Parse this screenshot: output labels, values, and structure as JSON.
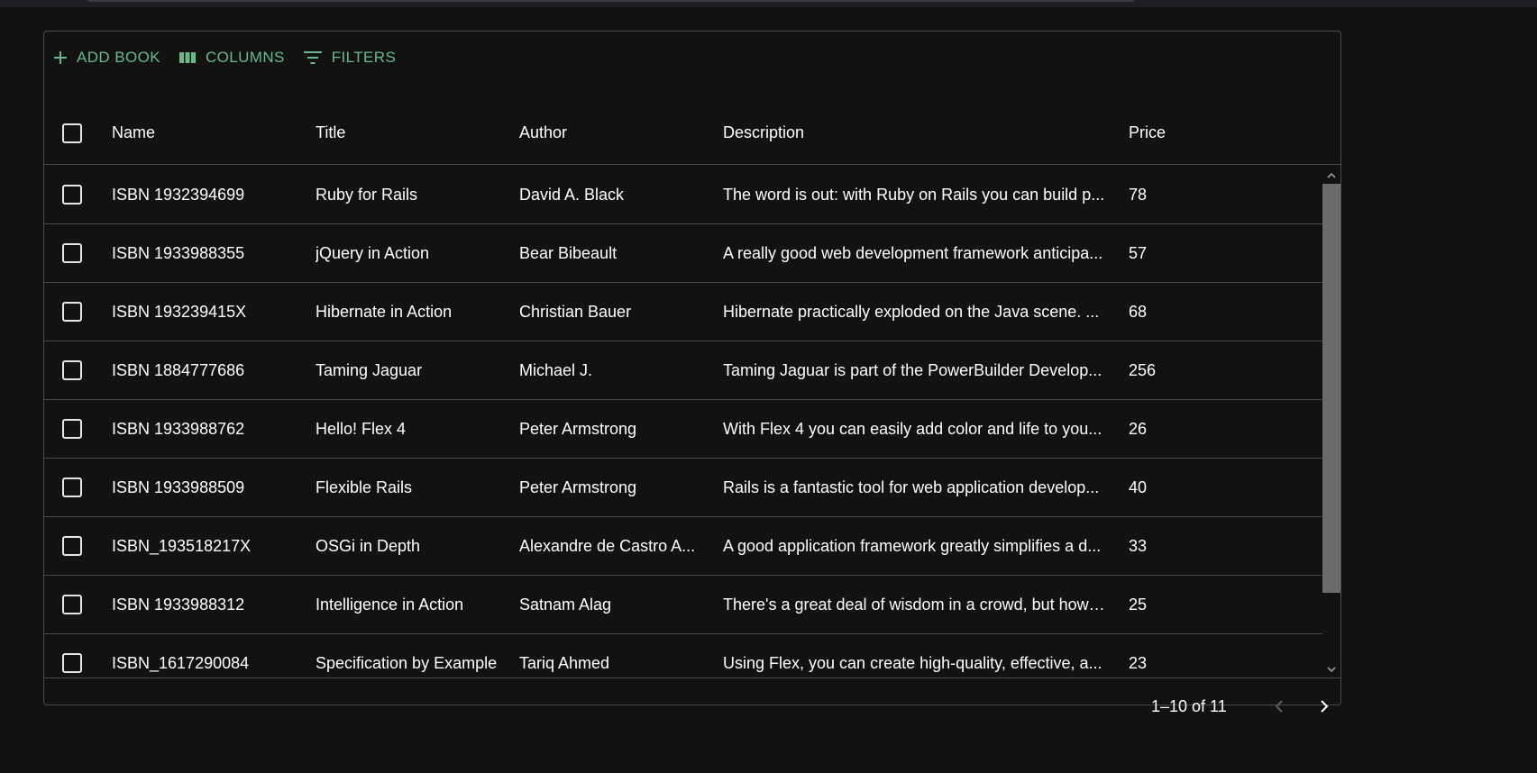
{
  "toolbar": {
    "add_label": "Add Book",
    "columns_label": "Columns",
    "filters_label": "Filters"
  },
  "columns": [
    "Name",
    "Title",
    "Author",
    "Description",
    "Price"
  ],
  "rows": [
    {
      "name": "ISBN 1932394699",
      "title": "Ruby for Rails",
      "author": "David A. Black",
      "description": "The word is out: with Ruby on Rails you can build p...",
      "price": "78"
    },
    {
      "name": "ISBN 1933988355",
      "title": "jQuery in Action",
      "author": "Bear Bibeault",
      "description": "A really good web development framework anticipa...",
      "price": "57"
    },
    {
      "name": "ISBN 193239415X",
      "title": "Hibernate in Action",
      "author": "Christian Bauer",
      "description": "Hibernate practically exploded on the Java scene. ...",
      "price": "68"
    },
    {
      "name": "ISBN 1884777686",
      "title": "Taming Jaguar",
      "author": "Michael J.",
      "description": "Taming Jaguar is part of the PowerBuilder Develop...",
      "price": "256"
    },
    {
      "name": "ISBN 1933988762",
      "title": "Hello! Flex 4",
      "author": "Peter Armstrong",
      "description": "With Flex 4 you can easily add color and life to you...",
      "price": "26"
    },
    {
      "name": "ISBN 1933988509",
      "title": "Flexible Rails",
      "author": "Peter Armstrong",
      "description": "Rails is a fantastic tool for web application develop...",
      "price": "40"
    },
    {
      "name": "ISBN_193518217X",
      "title": "OSGi in Depth",
      "author": "Alexandre de Castro A...",
      "description": "A good application framework greatly simplifies a d...",
      "price": "33"
    },
    {
      "name": "ISBN 1933988312",
      "title": "Intelligence in Action",
      "author": "Satnam Alag",
      "description": "There's a great deal of wisdom in a crowd, but how ...",
      "price": "25"
    },
    {
      "name": "ISBN_1617290084",
      "title": "Specification by Example",
      "author": "Tariq Ahmed",
      "description": "Using Flex, you can create high-quality, effective, a...",
      "price": "23"
    }
  ],
  "pagination": {
    "range": "1–10 of 11"
  },
  "icons": {
    "add": "plus-icon",
    "columns": "columns-icon",
    "filters": "filter-icon",
    "prev": "chevron-left-icon",
    "next": "chevron-right-icon"
  },
  "colors": {
    "accent": "#66bb8a",
    "background": "#121212",
    "border": "#4a4a4a"
  }
}
